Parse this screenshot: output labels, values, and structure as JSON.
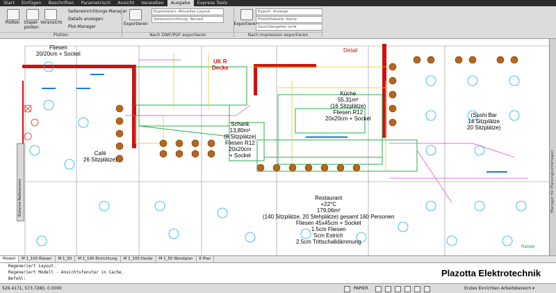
{
  "ribbon_tabs": [
    "Start",
    "Einfügen",
    "Beschriften",
    "Parametrisch",
    "Ansicht",
    "Verwalten",
    "Ausgabe",
    "Express Tools"
  ],
  "active_tab": "Ausgabe",
  "ribbon": {
    "plot_label": "Plotten",
    "batch_plot_label": "Stapel-\nplotten",
    "preview_label": "Voransicht",
    "setup_manager": "Seiteneinrichtungs-Manager",
    "details": "Details anzeigen",
    "plot_manager": "Plot-Manager",
    "group_plot": "Plotten",
    "export_btn": "Exportieren",
    "export_combo": "Exportieren: Aktuelles Layout",
    "setup_combo": "Seiteneinrichtung: Aktuell",
    "group_dwf": "Nach DWF/PDF exportieren",
    "export_btn2": "Exportieren",
    "impression_export": "Export: Anzeige",
    "plotstyle": "Plotstiltabelle: Keine",
    "lineweight": "Geschlängelter sch▾",
    "group_impression": "Nach Impression exportieren"
  },
  "drawing": {
    "labels": {
      "cafe": "Café\n26 Sitzplätze)",
      "sushi": "(Sushi Bar\n14 Sitzplätze\n20 Sitzplätze)",
      "kueche": "Küche\n55,31m²\n(16 Sitzplätze)\nFliesen R12\n20x20cm + Sockel",
      "schank": "Schank\n13,80m²\n(8 Sitzplätze)\nFliesen R12\n20x20cm\n+ Sockel",
      "restaurant": "Restaurant\n+22°C\n179,06m²\n(140 Sitzplätze, 20 Stehplätze) gesamt 160 Personen\nFliesen 45x45cm + Sockel\n1.5cm Fliesen\n5cm Estrich\n2.5cm Trittschalldämmung",
      "top_left": "Fliesen\n20/20cm + Sockel",
      "uk": "UK R\nDecke",
      "detail": "Detail",
      "rampe": "Rampe"
    },
    "right_panel": "Manager für Planungsunterlagen",
    "left_panel": "Externe Referenzen"
  },
  "layout_tabs": [
    "Modell",
    "M 1_100 Riesen",
    "M 1_50",
    "M 1_100 Einrichtung",
    "M 1_100 Decke",
    "M 1_50 Wandplan",
    "E Plan"
  ],
  "active_layout": "Modell",
  "command_lines": [
    "Regeneriert Layout.",
    "Regeneriert Modell - Ansichtsfenster in Cache.",
    "Befehl:"
  ],
  "brand": "Plazotta Elektrotechnik",
  "status": {
    "coords": "526.4171, 573.7280, 0.0000",
    "papier": "PAPIER",
    "workspace": "Erstes Einrichten Arbeitsbereich ▾"
  }
}
